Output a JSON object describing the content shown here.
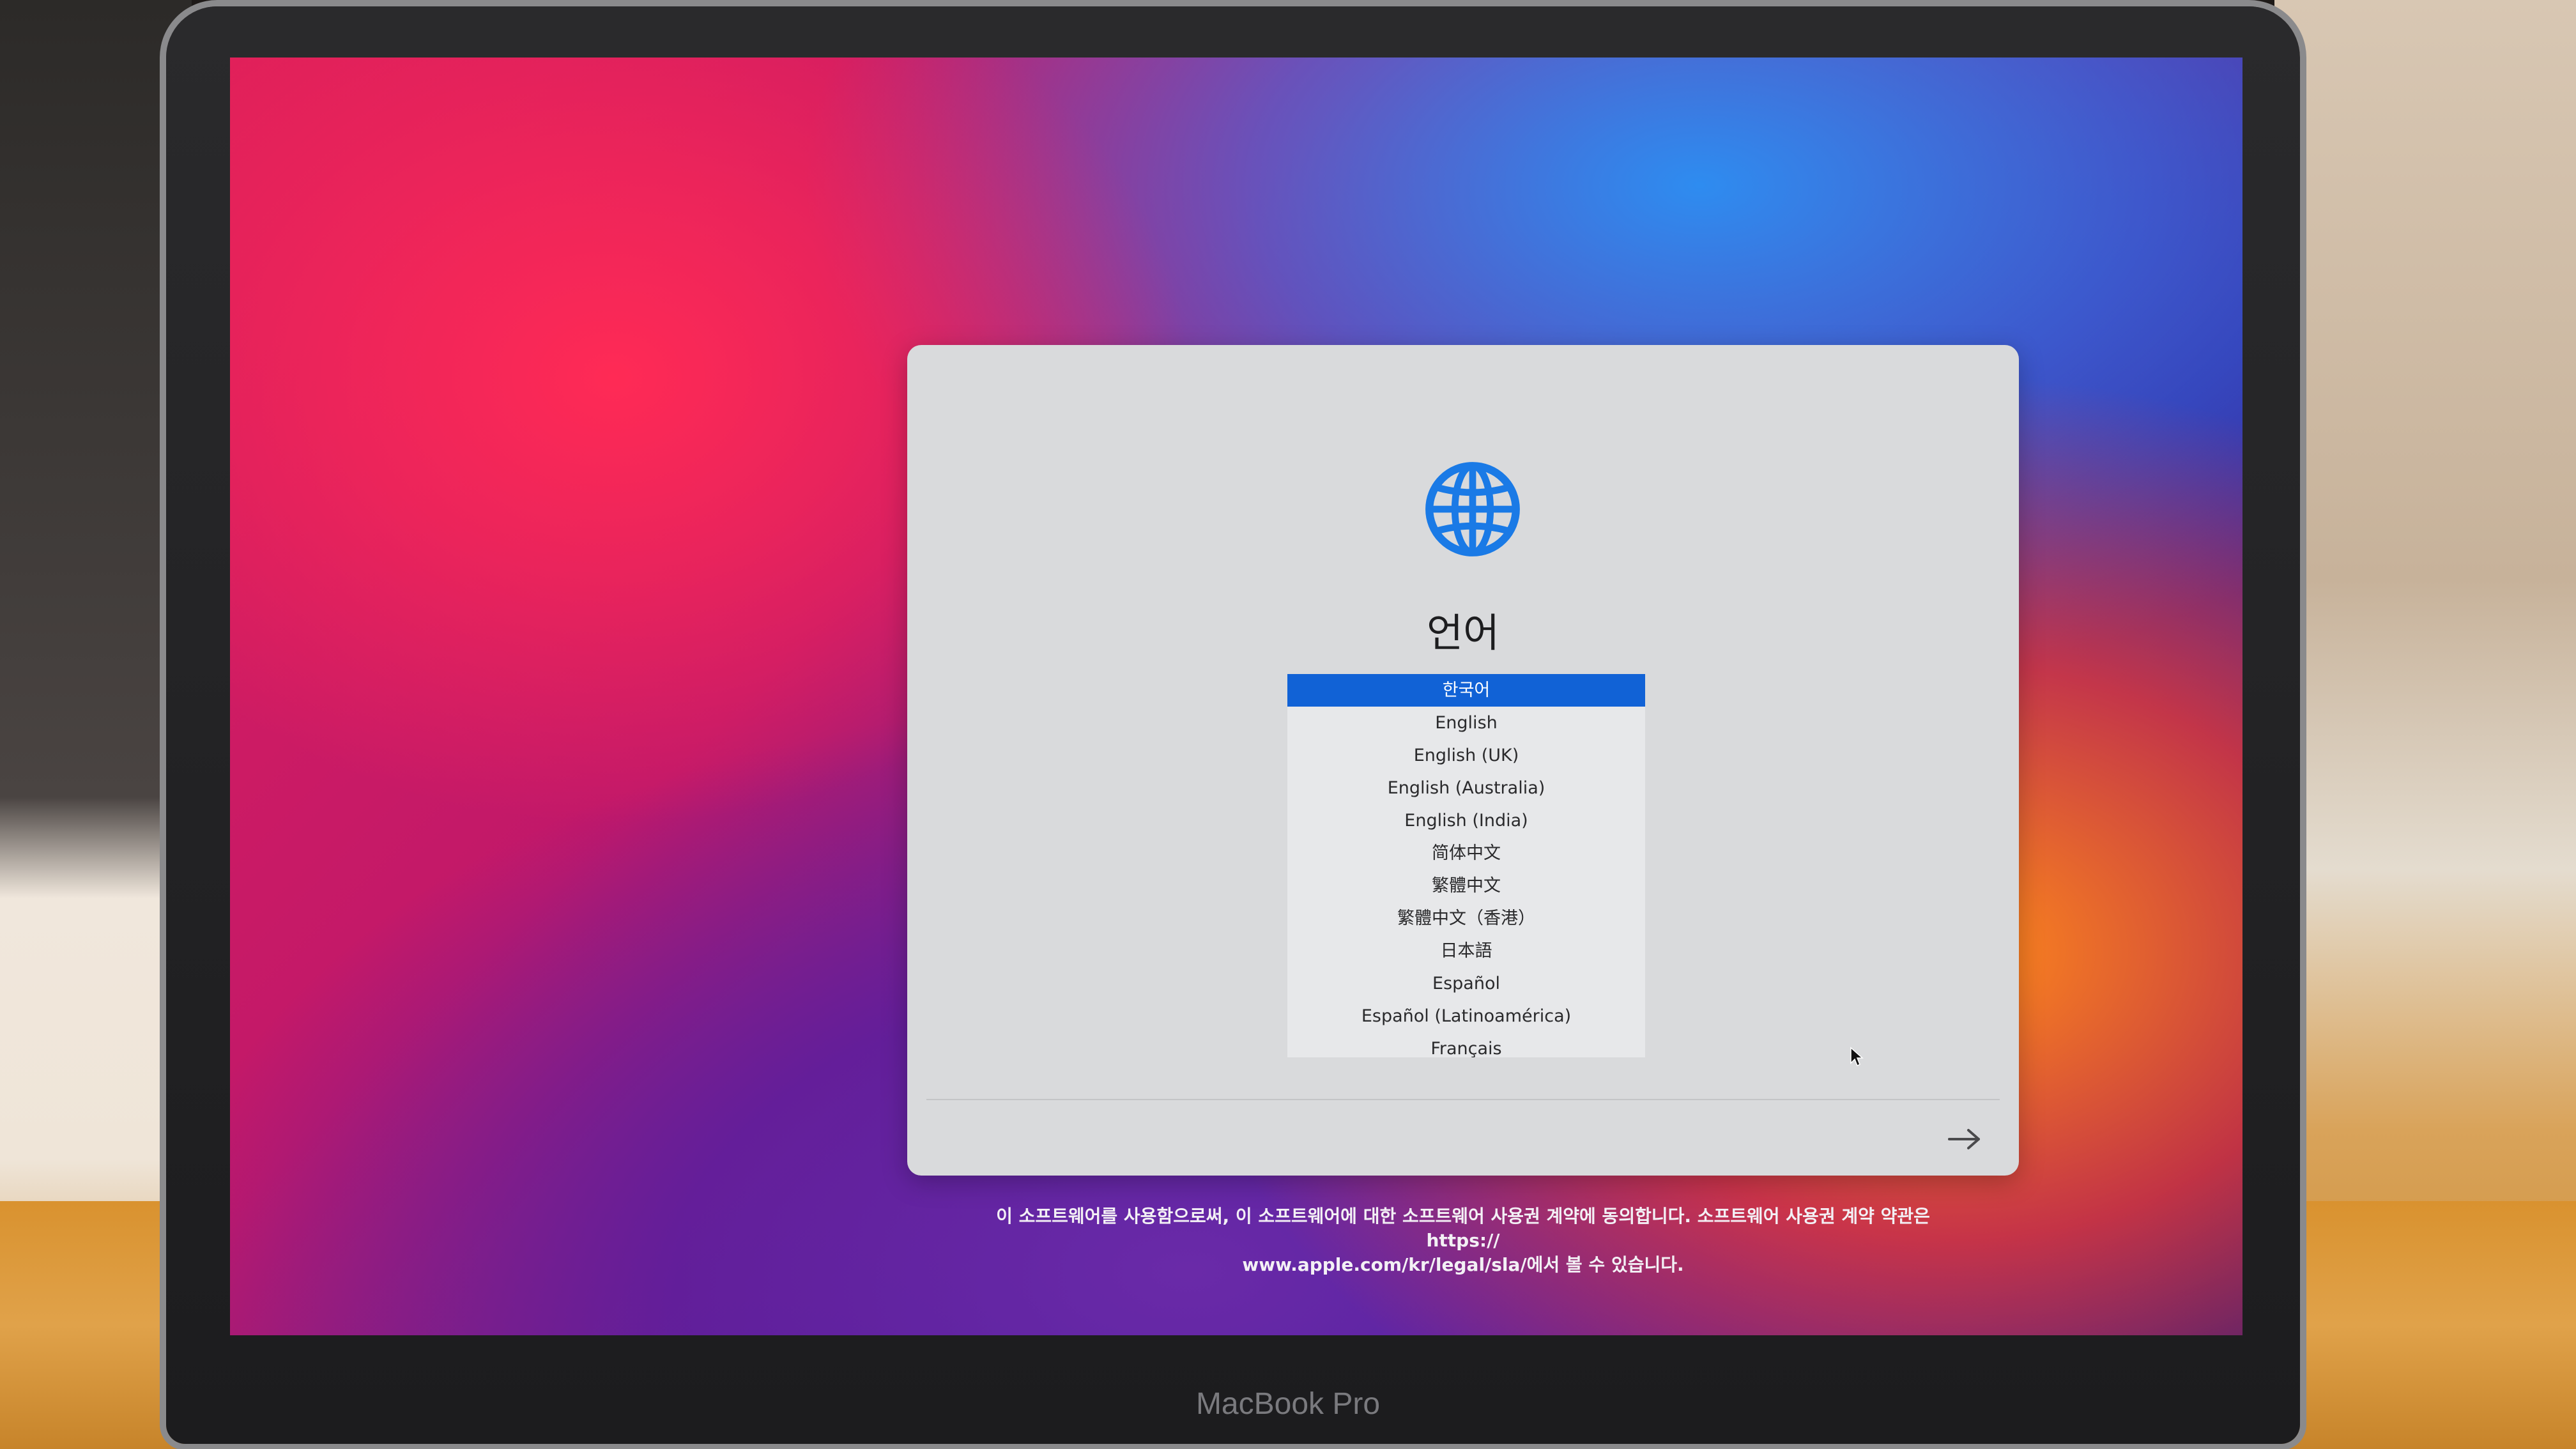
{
  "device": {
    "brand_label": "MacBook Pro"
  },
  "setup": {
    "icon": "globe-icon",
    "title": "언어",
    "languages": [
      {
        "label": "한국어",
        "selected": true
      },
      {
        "label": "English",
        "selected": false
      },
      {
        "label": "English (UK)",
        "selected": false
      },
      {
        "label": "English (Australia)",
        "selected": false
      },
      {
        "label": "English (India)",
        "selected": false
      },
      {
        "label": "简体中文",
        "selected": false
      },
      {
        "label": "繁體中文",
        "selected": false
      },
      {
        "label": "繁體中文（香港）",
        "selected": false
      },
      {
        "label": "日本語",
        "selected": false
      },
      {
        "label": "Español",
        "selected": false
      },
      {
        "label": "Español (Latinoamérica)",
        "selected": false
      },
      {
        "label": "Français",
        "selected": false
      }
    ],
    "next_icon": "arrow-right-icon",
    "license_line1": "이 소프트웨어를 사용함으로써, 이 소프트웨어에 대한 소프트웨어 사용권 계약에 동의합니다. 소프트웨어 사용권 계약 약관은 https://",
    "license_line2": "www.apple.com/kr/legal/sla/에서 볼 수 있습니다."
  },
  "colors": {
    "selection": "#1162d6",
    "globe": "#1a7ae6",
    "card": "#d9dadc"
  }
}
